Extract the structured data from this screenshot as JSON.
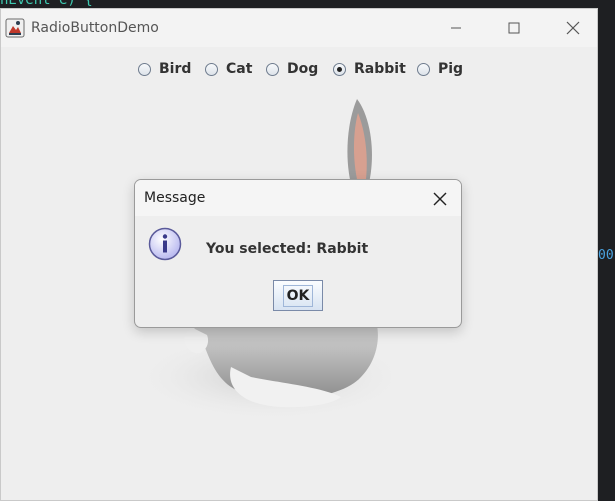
{
  "ide": {
    "code_top": "nEvent e) {",
    "code_side": "00"
  },
  "window": {
    "title": "RadioButtonDemo"
  },
  "radios": [
    {
      "label": "Bird",
      "checked": false
    },
    {
      "label": "Cat",
      "checked": false
    },
    {
      "label": "Dog",
      "checked": false
    },
    {
      "label": "Rabbit",
      "checked": true
    },
    {
      "label": "Pig",
      "checked": false
    }
  ],
  "dialog": {
    "title": "Message",
    "message": "You selected: Rabbit",
    "ok_label": "OK",
    "icon": "info-icon"
  },
  "colors": {
    "window_bg": "#eeeeee",
    "ide_bg": "#1e1f22",
    "ok_button_border": "#7a8aa8"
  }
}
